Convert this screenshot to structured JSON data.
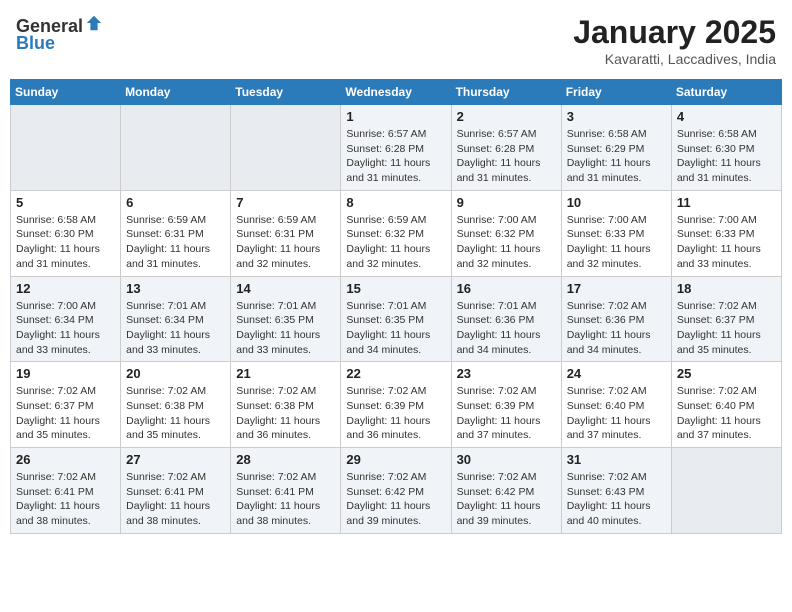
{
  "header": {
    "logo_general": "General",
    "logo_blue": "Blue",
    "month": "January 2025",
    "location": "Kavaratti, Laccadives, India"
  },
  "days_of_week": [
    "Sunday",
    "Monday",
    "Tuesday",
    "Wednesday",
    "Thursday",
    "Friday",
    "Saturday"
  ],
  "weeks": [
    [
      {
        "day": "",
        "empty": true
      },
      {
        "day": "",
        "empty": true
      },
      {
        "day": "",
        "empty": true
      },
      {
        "day": "1",
        "sunrise": "6:57 AM",
        "sunset": "6:28 PM",
        "daylight": "11 hours and 31 minutes."
      },
      {
        "day": "2",
        "sunrise": "6:57 AM",
        "sunset": "6:28 PM",
        "daylight": "11 hours and 31 minutes."
      },
      {
        "day": "3",
        "sunrise": "6:58 AM",
        "sunset": "6:29 PM",
        "daylight": "11 hours and 31 minutes."
      },
      {
        "day": "4",
        "sunrise": "6:58 AM",
        "sunset": "6:30 PM",
        "daylight": "11 hours and 31 minutes."
      }
    ],
    [
      {
        "day": "5",
        "sunrise": "6:58 AM",
        "sunset": "6:30 PM",
        "daylight": "11 hours and 31 minutes."
      },
      {
        "day": "6",
        "sunrise": "6:59 AM",
        "sunset": "6:31 PM",
        "daylight": "11 hours and 31 minutes."
      },
      {
        "day": "7",
        "sunrise": "6:59 AM",
        "sunset": "6:31 PM",
        "daylight": "11 hours and 32 minutes."
      },
      {
        "day": "8",
        "sunrise": "6:59 AM",
        "sunset": "6:32 PM",
        "daylight": "11 hours and 32 minutes."
      },
      {
        "day": "9",
        "sunrise": "7:00 AM",
        "sunset": "6:32 PM",
        "daylight": "11 hours and 32 minutes."
      },
      {
        "day": "10",
        "sunrise": "7:00 AM",
        "sunset": "6:33 PM",
        "daylight": "11 hours and 32 minutes."
      },
      {
        "day": "11",
        "sunrise": "7:00 AM",
        "sunset": "6:33 PM",
        "daylight": "11 hours and 33 minutes."
      }
    ],
    [
      {
        "day": "12",
        "sunrise": "7:00 AM",
        "sunset": "6:34 PM",
        "daylight": "11 hours and 33 minutes."
      },
      {
        "day": "13",
        "sunrise": "7:01 AM",
        "sunset": "6:34 PM",
        "daylight": "11 hours and 33 minutes."
      },
      {
        "day": "14",
        "sunrise": "7:01 AM",
        "sunset": "6:35 PM",
        "daylight": "11 hours and 33 minutes."
      },
      {
        "day": "15",
        "sunrise": "7:01 AM",
        "sunset": "6:35 PM",
        "daylight": "11 hours and 34 minutes."
      },
      {
        "day": "16",
        "sunrise": "7:01 AM",
        "sunset": "6:36 PM",
        "daylight": "11 hours and 34 minutes."
      },
      {
        "day": "17",
        "sunrise": "7:02 AM",
        "sunset": "6:36 PM",
        "daylight": "11 hours and 34 minutes."
      },
      {
        "day": "18",
        "sunrise": "7:02 AM",
        "sunset": "6:37 PM",
        "daylight": "11 hours and 35 minutes."
      }
    ],
    [
      {
        "day": "19",
        "sunrise": "7:02 AM",
        "sunset": "6:37 PM",
        "daylight": "11 hours and 35 minutes."
      },
      {
        "day": "20",
        "sunrise": "7:02 AM",
        "sunset": "6:38 PM",
        "daylight": "11 hours and 35 minutes."
      },
      {
        "day": "21",
        "sunrise": "7:02 AM",
        "sunset": "6:38 PM",
        "daylight": "11 hours and 36 minutes."
      },
      {
        "day": "22",
        "sunrise": "7:02 AM",
        "sunset": "6:39 PM",
        "daylight": "11 hours and 36 minutes."
      },
      {
        "day": "23",
        "sunrise": "7:02 AM",
        "sunset": "6:39 PM",
        "daylight": "11 hours and 37 minutes."
      },
      {
        "day": "24",
        "sunrise": "7:02 AM",
        "sunset": "6:40 PM",
        "daylight": "11 hours and 37 minutes."
      },
      {
        "day": "25",
        "sunrise": "7:02 AM",
        "sunset": "6:40 PM",
        "daylight": "11 hours and 37 minutes."
      }
    ],
    [
      {
        "day": "26",
        "sunrise": "7:02 AM",
        "sunset": "6:41 PM",
        "daylight": "11 hours and 38 minutes."
      },
      {
        "day": "27",
        "sunrise": "7:02 AM",
        "sunset": "6:41 PM",
        "daylight": "11 hours and 38 minutes."
      },
      {
        "day": "28",
        "sunrise": "7:02 AM",
        "sunset": "6:41 PM",
        "daylight": "11 hours and 38 minutes."
      },
      {
        "day": "29",
        "sunrise": "7:02 AM",
        "sunset": "6:42 PM",
        "daylight": "11 hours and 39 minutes."
      },
      {
        "day": "30",
        "sunrise": "7:02 AM",
        "sunset": "6:42 PM",
        "daylight": "11 hours and 39 minutes."
      },
      {
        "day": "31",
        "sunrise": "7:02 AM",
        "sunset": "6:43 PM",
        "daylight": "11 hours and 40 minutes."
      },
      {
        "day": "",
        "empty": true
      }
    ]
  ],
  "labels": {
    "sunrise": "Sunrise:",
    "sunset": "Sunset:",
    "daylight": "Daylight:"
  }
}
